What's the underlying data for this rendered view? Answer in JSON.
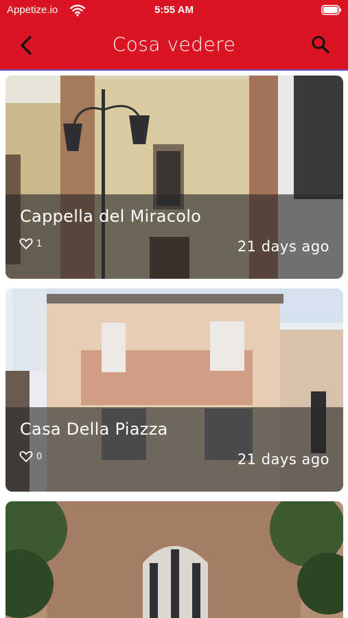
{
  "status_bar": {
    "carrier": "Appetize.io",
    "time": "5:55 AM"
  },
  "header": {
    "title": "Cosa vedere",
    "accent_color": "#db1424"
  },
  "icons": [
    "back-icon",
    "search-icon",
    "wifi-icon",
    "battery-icon",
    "heart-icon"
  ],
  "cards": [
    {
      "title": "Cappella del Miracolo",
      "likes": "1",
      "ago": "21 days ago"
    },
    {
      "title": "Casa Della Piazza",
      "likes": "0",
      "ago": "21 days ago"
    }
  ]
}
